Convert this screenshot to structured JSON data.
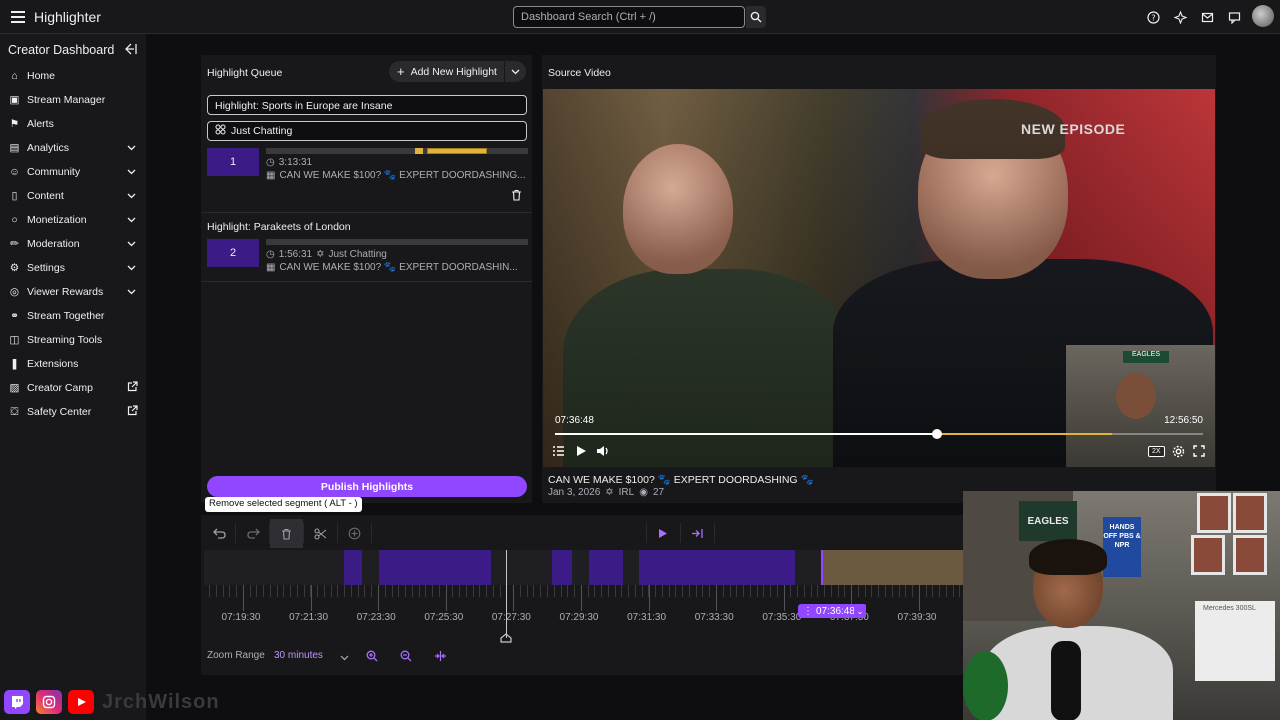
{
  "app": {
    "title": "Highlighter"
  },
  "search": {
    "placeholder": "Dashboard Search (Ctrl + /)"
  },
  "sidebar": {
    "header": "Creator Dashboard",
    "items": [
      {
        "label": "Home",
        "icon": "home-icon"
      },
      {
        "label": "Stream Manager",
        "icon": "stream-manager-icon"
      },
      {
        "label": "Alerts",
        "icon": "alerts-icon"
      },
      {
        "label": "Analytics",
        "icon": "analytics-icon",
        "expandable": true
      },
      {
        "label": "Community",
        "icon": "community-icon",
        "expandable": true
      },
      {
        "label": "Content",
        "icon": "content-icon",
        "expandable": true
      },
      {
        "label": "Monetization",
        "icon": "monetization-icon",
        "expandable": true
      },
      {
        "label": "Moderation",
        "icon": "moderation-icon",
        "expandable": true
      },
      {
        "label": "Settings",
        "icon": "settings-icon",
        "expandable": true
      },
      {
        "label": "Viewer Rewards",
        "icon": "viewer-rewards-icon",
        "expandable": true
      },
      {
        "label": "Stream Together",
        "icon": "stream-together-icon"
      },
      {
        "label": "Streaming Tools",
        "icon": "streaming-tools-icon"
      },
      {
        "label": "Extensions",
        "icon": "extensions-icon"
      },
      {
        "label": "Creator Camp",
        "icon": "creator-camp-icon",
        "external": true
      },
      {
        "label": "Safety Center",
        "icon": "safety-center-icon",
        "external": true
      }
    ]
  },
  "queue": {
    "title": "Highlight Queue",
    "add_label": "Add New Highlight",
    "current_title": "Highlight: Sports in Europe are Insane",
    "current_category": "Just Chatting",
    "items": [
      {
        "number": "1",
        "duration": "3:13:31",
        "category": "",
        "stream_title": "CAN WE MAKE $100? 🐾 EXPERT DOORDASHING..."
      },
      {
        "number": "2",
        "title": "Highlight: Parakeets of London",
        "duration": "1:56:31",
        "category": "Just Chatting",
        "stream_title": "CAN WE MAKE $100? 🐾 EXPERT DOORDASHIN..."
      }
    ],
    "publish_label": "Publish Highlights"
  },
  "video": {
    "title": "Source Video",
    "overlay_text": "NEW EPISODE",
    "current_time": "07:36:48",
    "total_time": "12:56:50",
    "progress": 0.59,
    "selection_end": 0.86,
    "speed": "2X",
    "stream_title": "CAN WE MAKE $100? 🐾 EXPERT DOORDASHING 🐾",
    "date": "Jan 3, 2026",
    "category": "IRL",
    "views": "27"
  },
  "editor": {
    "tooltip": "Remove selected segment ( ALT - )",
    "ruler_labels": [
      "07:19:30",
      "07:21:30",
      "07:23:30",
      "07:25:30",
      "07:27:30",
      "07:29:30",
      "07:31:30",
      "07:33:30",
      "07:35:30",
      "07:37:30",
      "07:39:30"
    ],
    "position_label": "07:36:48",
    "zoom_label": "Zoom Range",
    "zoom_value": "30 minutes"
  },
  "webcam": {
    "poster1": "EAGLES",
    "poster2": "HANDS OFF PBS & NPR",
    "box_label": "Mercedes 300SL"
  },
  "footer": {
    "handle": "JrchWilson"
  },
  "colors": {
    "accent": "#9147ff",
    "segment": "#3b1b85",
    "selection": "#e2b33b",
    "background": "#0e0e10",
    "panel": "#18181b"
  }
}
